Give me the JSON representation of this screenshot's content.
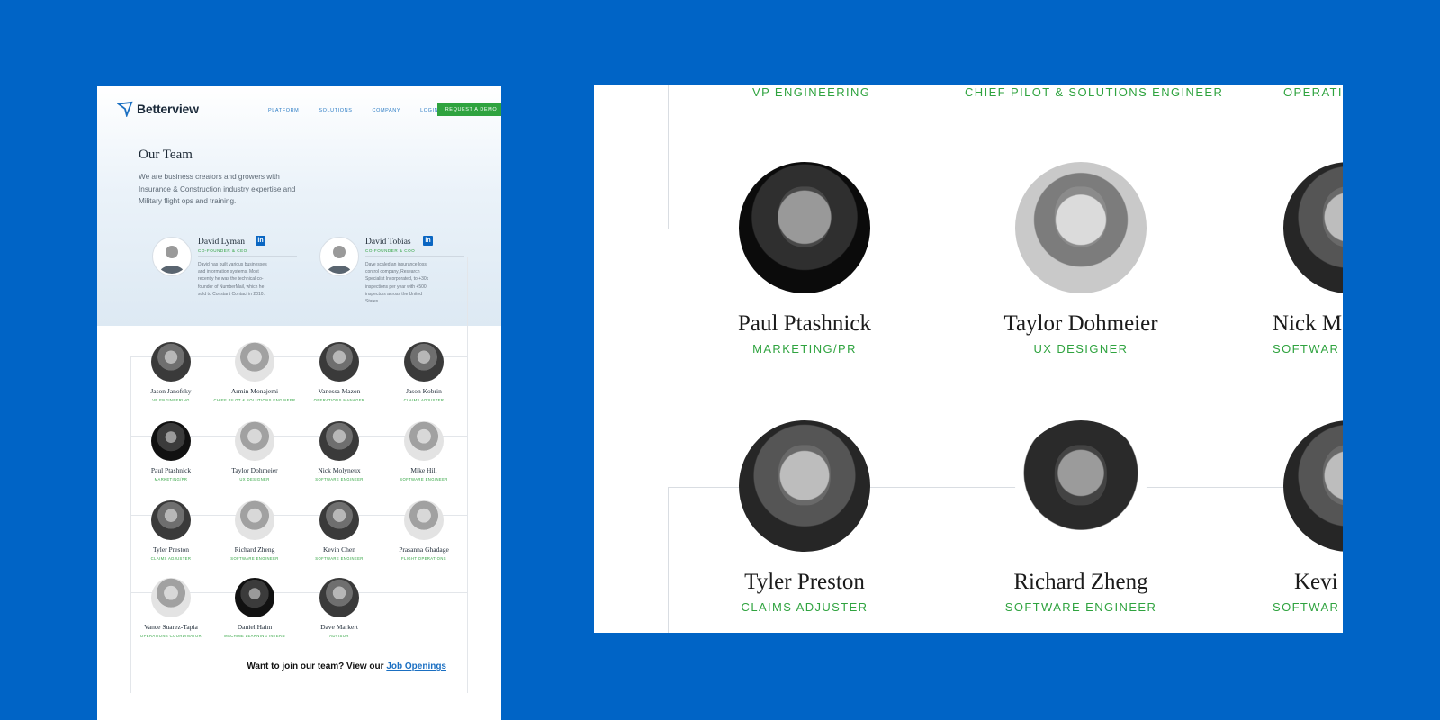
{
  "brand": {
    "name": "Betterview",
    "accent": "#2fa33f",
    "link": "#1a6fc2",
    "background": "#0064c6"
  },
  "nav": {
    "links": [
      "PLATFORM",
      "SOLUTIONS",
      "COMPANY",
      "LOGIN"
    ],
    "cta": "REQUEST A DEMO"
  },
  "hero": {
    "title": "Our Team",
    "description": "We are business creators and growers with Insurance & Construction industry expertise and Military flight ops and training."
  },
  "founders": [
    {
      "name": "David Lyman",
      "role": "CO-FOUNDER & CEO",
      "bio": "David has built various businesses and information systems. Most recently he was the technical co-founder of NumberMail, which he sold to Constant Contact in 2010.",
      "icon": "linkedin-icon"
    },
    {
      "name": "David Tobias",
      "role": "CO-FOUNDER & COO",
      "bio": "Dave scaled an insurance loss control company, Research Specialist Incorporated, to +30k inspections per year with +500 inspectors across the United States.",
      "icon": "linkedin-icon"
    }
  ],
  "team": [
    {
      "name": "Jason Janofsky",
      "role": "VP ENGINEERING"
    },
    {
      "name": "Armin Monajemi",
      "role": "CHIEF PILOT & SOLUTIONS ENGINEER"
    },
    {
      "name": "Vanessa Mazon",
      "role": "OPERATIONS MANAGER"
    },
    {
      "name": "Jason Kobrin",
      "role": "CLAIMS ADJUSTER"
    },
    {
      "name": "Paul Ptashnick",
      "role": "MARKETING/PR"
    },
    {
      "name": "Taylor Dohmeier",
      "role": "UX DESIGNER"
    },
    {
      "name": "Nick Molyneux",
      "role": "SOFTWARE ENGINEER"
    },
    {
      "name": "Mike Hill",
      "role": "SOFTWARE ENGINEER"
    },
    {
      "name": "Tyler Preston",
      "role": "CLAIMS ADJUSTER"
    },
    {
      "name": "Richard Zheng",
      "role": "SOFTWARE ENGINEER"
    },
    {
      "name": "Kevin Chen",
      "role": "SOFTWARE ENGINEER"
    },
    {
      "name": "Prasanna Ghadage",
      "role": "FLIGHT OPERATIONS"
    },
    {
      "name": "Vance Suarez-Tapia",
      "role": "OPERATIONS COORDINATOR"
    },
    {
      "name": "Daniel Haim",
      "role": "MACHINE LEARNING INTERN"
    },
    {
      "name": "Dave Markert",
      "role": "ADVISOR"
    }
  ],
  "join": {
    "text": "Want to join our team? View our ",
    "link": "Job Openings"
  },
  "zoom": {
    "top_roles": [
      "VP ENGINEERING",
      "CHIEF PILOT & SOLUTIONS ENGINEER",
      "OPERATIO"
    ],
    "row1": [
      {
        "name": "Paul Ptashnick",
        "role": "MARKETING/PR"
      },
      {
        "name": "Taylor Dohmeier",
        "role": "UX DESIGNER"
      },
      {
        "name": "Nick M",
        "role": "SOFTWAR"
      }
    ],
    "row2": [
      {
        "name": "Tyler Preston",
        "role": "CLAIMS ADJUSTER"
      },
      {
        "name": "Richard Zheng",
        "role": "SOFTWARE ENGINEER"
      },
      {
        "name": "Kevi",
        "role": "SOFTWAR"
      }
    ]
  }
}
